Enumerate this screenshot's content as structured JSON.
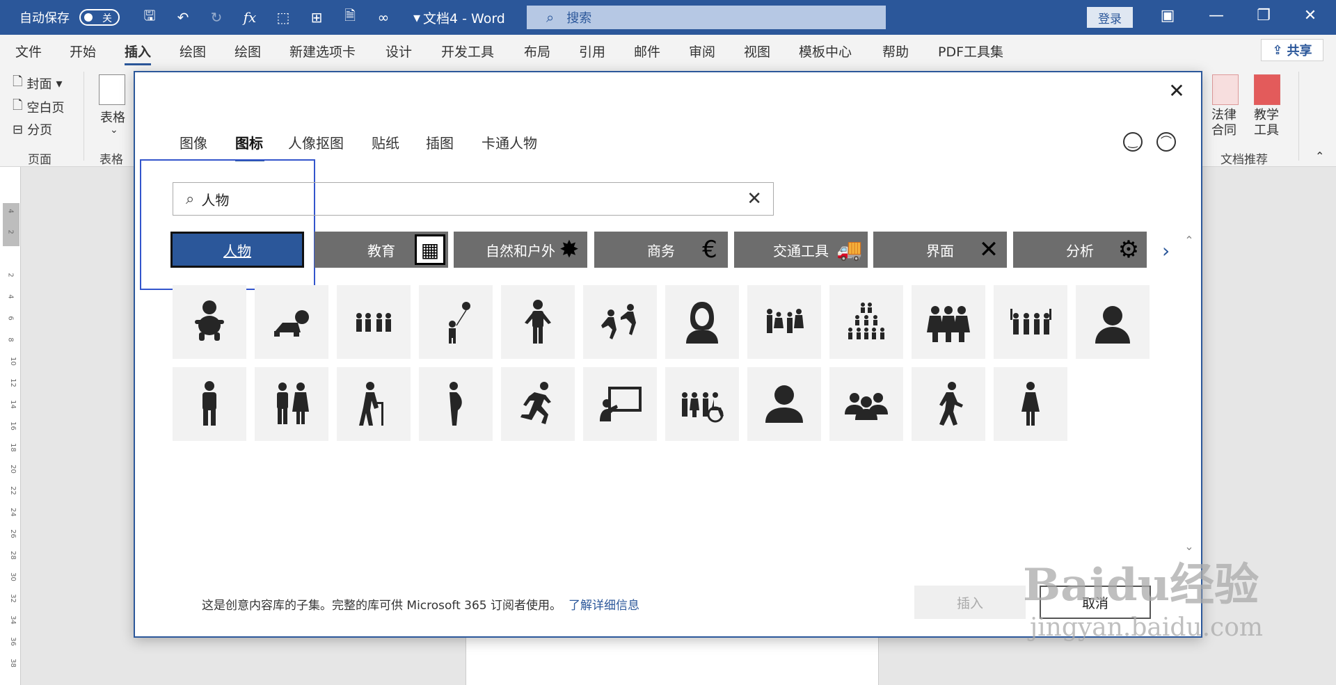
{
  "titlebar": {
    "autosave_label": "自动保存",
    "autosave_state": "关",
    "doc_title": "文档4 - Word",
    "search_placeholder": "搜索",
    "login": "登录"
  },
  "ribbon_tabs": [
    "文件",
    "开始",
    "插入",
    "绘图",
    "绘图",
    "新建选项卡",
    "设计",
    "开发工具",
    "布局",
    "引用",
    "邮件",
    "审阅",
    "视图",
    "模板中心",
    "帮助",
    "PDF工具集"
  ],
  "share_label": "共享",
  "ribbon": {
    "cover": "封面",
    "blank_page": "空白页",
    "page_break": "分页",
    "group_pages": "页面",
    "table": "表格",
    "group_table": "表格",
    "legal": "法律\n合同",
    "teaching": "教学\n工具",
    "group_recommend": "文档推荐"
  },
  "ruler_numbers": [
    "4",
    "2",
    "2",
    "4",
    "6",
    "8",
    "10",
    "12",
    "14",
    "16",
    "18",
    "20",
    "22",
    "24",
    "26",
    "28",
    "30",
    "32",
    "34",
    "36",
    "38"
  ],
  "dialog": {
    "tabs": [
      "图像",
      "图标",
      "人像抠图",
      "贴纸",
      "插图",
      "卡通人物"
    ],
    "active_tab": "图标",
    "search_value": "人物",
    "categories": [
      {
        "label": "人物",
        "icon": "none"
      },
      {
        "label": "教育",
        "icon": "calculator-icon"
      },
      {
        "label": "自然和户外",
        "icon": "splat-icon"
      },
      {
        "label": "商务",
        "icon": "euro-icon"
      },
      {
        "label": "交通工具",
        "icon": "truck-icon"
      },
      {
        "label": "界面",
        "icon": "close-x-icon"
      },
      {
        "label": "分析",
        "icon": "gears-icon"
      }
    ],
    "icons": [
      "baby-icon",
      "crawling-baby-icon",
      "group-of-four-icon",
      "child-balloon-icon",
      "man-shrug-icon",
      "dancing-pair-icon",
      "woman-portrait-icon",
      "family-four-icon",
      "crowd-icon",
      "women-group-icon",
      "cheering-group-icon",
      "user-profile-icon",
      "man-standing-icon",
      "couple-icon",
      "elderly-cane-icon",
      "pregnant-woman-icon",
      "running-man-icon",
      "presenter-board-icon",
      "accessibility-group-icon",
      "person-silhouette-icon",
      "team-three-icon",
      "walking-man-icon",
      "woman-standing-icon"
    ],
    "footer_note": "这是创意内容库的子集。完整的库可供 Microsoft 365 订阅者使用。",
    "learn_more": "了解详细信息",
    "insert": "插入",
    "cancel": "取消"
  },
  "watermark": {
    "brand": "Baidu经验",
    "url": "jingyan.baidu.com"
  }
}
